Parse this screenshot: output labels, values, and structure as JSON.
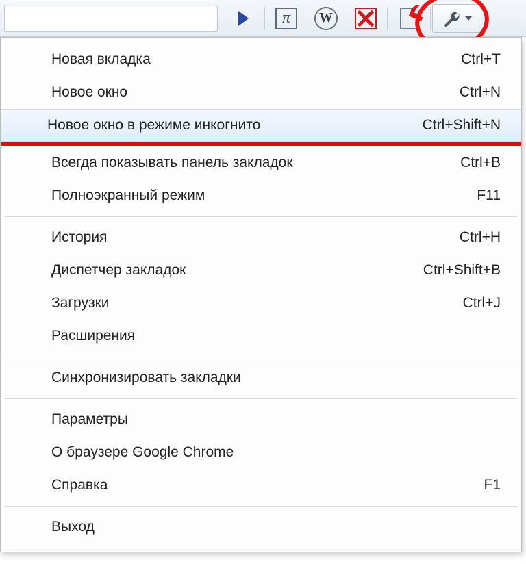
{
  "toolbar": {
    "play_icon": "play-icon",
    "pi_letter": "π",
    "w_letter": "W"
  },
  "menu": {
    "items": [
      {
        "label": "Новая вкладка",
        "shortcut": "Ctrl+T"
      },
      {
        "label": "Новое окно",
        "shortcut": "Ctrl+N"
      },
      {
        "label": "Новое окно в режиме инкогнито",
        "shortcut": "Ctrl+Shift+N",
        "highlight": true
      },
      {
        "sep": true,
        "red": true
      },
      {
        "label": "Всегда показывать панель закладок",
        "shortcut": "Ctrl+B"
      },
      {
        "label": "Полноэкранный режим",
        "shortcut": "F11"
      },
      {
        "sep": true
      },
      {
        "label": "История",
        "shortcut": "Ctrl+H"
      },
      {
        "label": "Диспетчер закладок",
        "shortcut": "Ctrl+Shift+B"
      },
      {
        "label": "Загрузки",
        "shortcut": "Ctrl+J"
      },
      {
        "label": "Расширения",
        "shortcut": ""
      },
      {
        "sep": true
      },
      {
        "label": "Синхронизировать закладки",
        "shortcut": ""
      },
      {
        "sep": true
      },
      {
        "label": "Параметры",
        "shortcut": ""
      },
      {
        "label": "О браузере Google Chrome",
        "shortcut": ""
      },
      {
        "label": "Справка",
        "shortcut": "F1"
      },
      {
        "sep": true
      },
      {
        "label": "Выход",
        "shortcut": ""
      }
    ]
  }
}
